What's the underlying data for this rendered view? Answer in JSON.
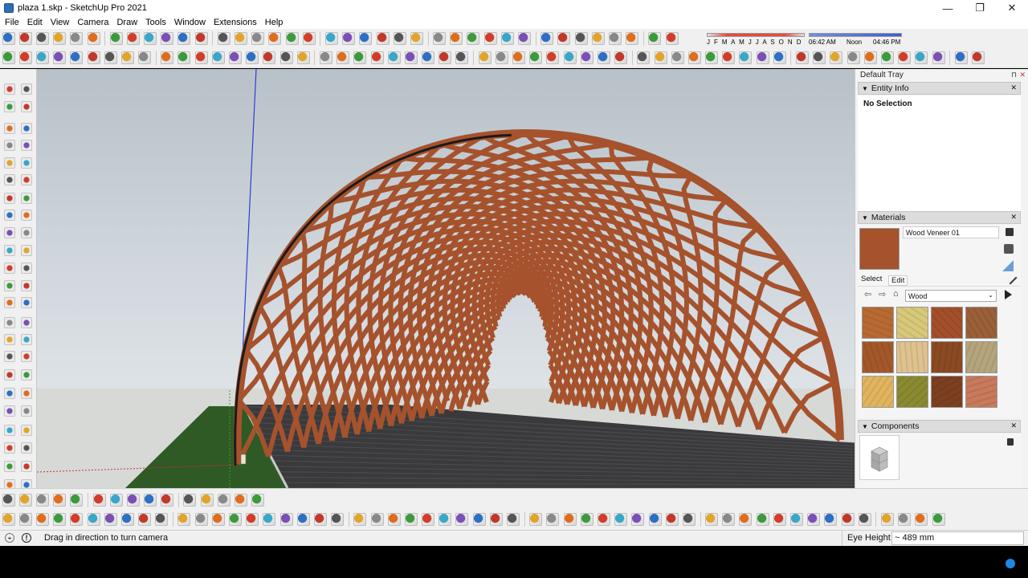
{
  "window": {
    "title": "plaza 1.skp - SketchUp Pro 2021",
    "minimize": "—",
    "maximize": "❐",
    "close": "✕"
  },
  "menu": [
    "File",
    "Edit",
    "View",
    "Camera",
    "Draw",
    "Tools",
    "Window",
    "Extensions",
    "Help"
  ],
  "shadows": {
    "months": "J F M A M J J A S O N D",
    "time_start": "06:42 AM",
    "time_mid": "Noon",
    "time_end": "04:46 PM"
  },
  "tray": {
    "title": "Default Tray",
    "pin": "⊓",
    "close": "✕",
    "entity_info": {
      "title": "Entity Info",
      "selection": "No Selection"
    },
    "materials": {
      "title": "Materials",
      "name": "Wood Veneer 01",
      "tab_select": "Select",
      "tab_edit": "Edit",
      "library": "Wood",
      "swatch_colors": [
        "#b86a33",
        "#d8c87a",
        "#a34f2a",
        "#9a6038",
        "#a4582a",
        "#e0c28e",
        "#8c4a22",
        "#b5a57c",
        "#e2b45e",
        "#8a8a30",
        "#7c4020",
        "#c87a5a"
      ]
    },
    "components": {
      "title": "Components"
    }
  },
  "status": {
    "message": "Drag in direction to turn camera",
    "measure_label": "Eye Height",
    "measure_value": "~ 489 mm"
  },
  "colors": {
    "wood": "#a5522d",
    "ground_grass": "#2f5a25",
    "plaza_floor": "#3a3a3c",
    "axis_blue": "#2b3fd6"
  }
}
